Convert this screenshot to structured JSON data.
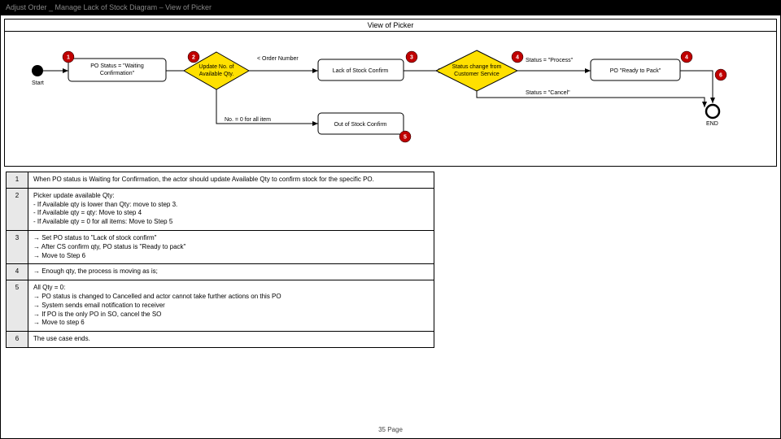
{
  "titlebar": "Adjust Order _ Manage Lack of Stock Diagram – View of Picker",
  "pool_title": "View of Picker",
  "footer": "35 Page",
  "nodes": {
    "start": "Start",
    "po_waiting": "PO Status = \"Waiting Confirmation\"",
    "update_qty": "Update No. of Available Qty.",
    "lack_confirm": "Lack of Stock Confirm",
    "status_change": "Status change from Customer Service",
    "po_ready": "PO \"Ready to Pack\"",
    "out_confirm": "Out of Stock Confirm",
    "end": "END"
  },
  "edge_labels": {
    "lt_order": "< Order Number",
    "zero_all": "No. = 0 for all item",
    "status_process": "Status = \"Process\"",
    "status_cancel": "Status = \"Cancel\""
  },
  "badges": [
    "1",
    "2",
    "3",
    "4",
    "4",
    "5",
    "6"
  ],
  "steps": [
    {
      "n": "1",
      "text": "When PO status is Waiting for Confirmation, the actor should update Available Qty to confirm stock for the specific PO."
    },
    {
      "n": "2",
      "text": "Picker update available Qty:\n    - If Available qty is lower than Qty: move to step 3.\n    - If Available qty = qty: Move to step 4\n    - If Available qty = 0 for all items: Move to Step 5"
    },
    {
      "n": "3",
      "text": "→ Set PO status to \"Lack of stock confirm\"\n→ After CS confirm qty, PO status is \"Ready to pack\"\n→ Move to Step 6"
    },
    {
      "n": "4",
      "text": "→ Enough qty, the process is moving as is;"
    },
    {
      "n": "5",
      "text": "All Qty = 0:\n→ PO status is changed to Cancelled and actor cannot take further actions on this PO\n→ System sends email notification to receiver\n→ If PO is the only PO in SO, cancel the SO\n→ Move to step 6"
    },
    {
      "n": "6",
      "text": "The use case ends."
    }
  ]
}
